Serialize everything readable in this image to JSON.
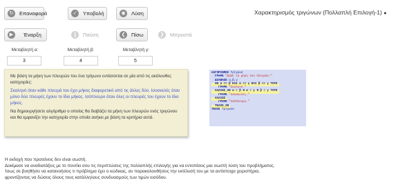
{
  "toolbar": {
    "reset": "Επαναφορά",
    "submit": "Υποβολή",
    "solution": "Λύση",
    "start": "Έναρξη",
    "pause": "Παύση",
    "back": "Πίσω",
    "forward": "Μπροστά"
  },
  "page_title": "Χαρακτηρισμός τριγώνων (Πολλαπλή Επιλογή-1)",
  "variables": [
    {
      "label": "Μεταβλητή α:",
      "value": "3"
    },
    {
      "label": "Μεταβλητή β:",
      "value": "4"
    },
    {
      "label": "Μεταβλητή γ:",
      "value": "5"
    }
  ],
  "problem": {
    "intro": "Με βάση τα μήκη των πλευρών του ένα τρίγωνο εντάσσεται σε μία από τις ακόλουθες κατηγορίες:",
    "scalene": "Σκαληνό όταν κάθε πλευρά του έχει μήκος διαφορετικό από τις άλλες δύο.",
    "isosceles": "Ισοσκελές όταν μόνο δύο πλευρές έχουν το ίδιο μήκος.",
    "equilateral": "Ισόπλευρο όταν όλες οι πλευρές του έχουν το ίδιο μήκος.",
    "task": "Να δημιουργήσετε αλγόριθμο ο οποίος θα διαβάζει τα μήκη των πλευρών ενός τριγώνου και θα εμφανίζει την κατηγορία στην οποία ανήκει με βάση τα κριτήρια αυτά."
  },
  "code": {
    "l1_kw": "ΑΛΓΟΡΙΘΜΟΣ",
    "l1_name": " Τρίγωνα",
    "l2_kw": "  ΓΡΑΨΕ",
    "l2_str": " \"Δώσε τα μήκη των πλευρών:\"",
    "l3_kw": "  ΔΙΑΒΑΣΕ",
    "l3_rest": " α,β,γ",
    "l4": "  ΑΝ α <> β ΚΑΙ α <> γ ΚΑΙ β <> γ ΤΟΤΕ",
    "l5_kw": "    ΓΡΑΨΕ",
    "l5_str": " \"Σκαληνό.\"",
    "l6": "  ΑΛΛΙΩΣ_ΑΝ α = β Ή α = γ Ή β = γ ΤΟΤΕ",
    "l7_kw": "    ΓΡΑΨΕ",
    "l7_str": " \"Ισοσκελές.\"",
    "l8": "  ΑΛΛΙΩΣ",
    "l9_kw": "    ΓΡΑΨΕ",
    "l9_str": " \"Ισόπλευρο.\"",
    "l10": "  ΤΕΛΟΣ_ΑΝ",
    "l11_kw": "ΤΕΛΟΣ",
    "l11_name": " Τρίγωνα"
  },
  "footer": [
    "Η εκδοχή που προτείνεις δεν είναι σωστή.",
    "Δοκίμασε να αναδιατάξεις με το ποντίκι σου τις περιπτώσεις της πολλαπλής επιλογής για να εντοπίσεις μια σωστή λύση του προβλήματος.",
    "Ίσως σε βοηθήσει να κατανοήσεις τι πρόβλημα έχει ο κώδικας, αν παρακολουθήσεις την εκτέλεσή του με τα αντίστοιχα χειριστήρια,",
    "φροντίζοντας να δώσεις όλους τους κατάλληλους συνδυασμούς των τιμών εισόδου."
  ]
}
